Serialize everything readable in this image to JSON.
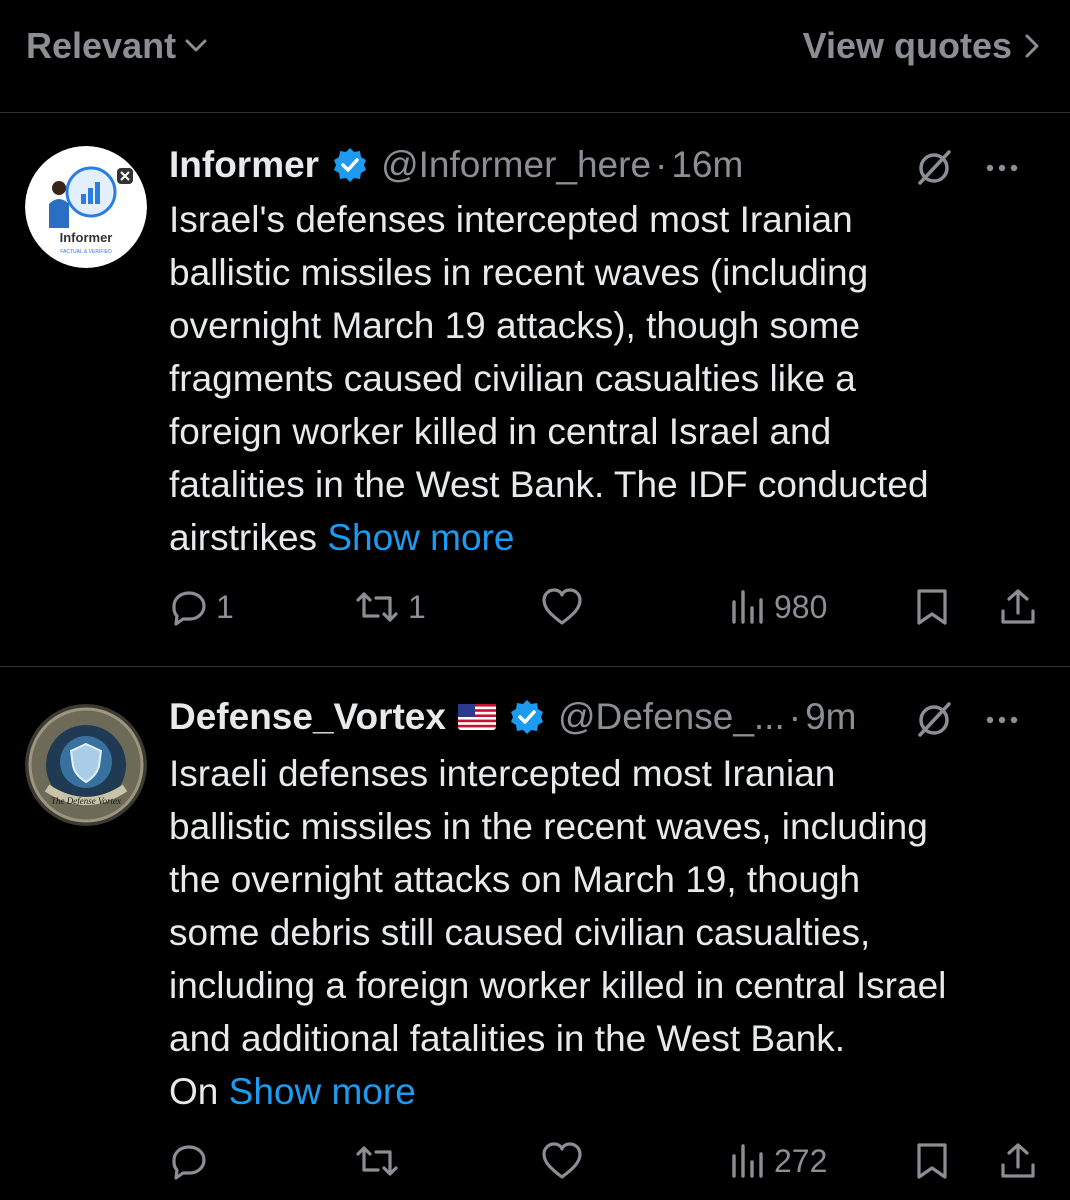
{
  "topbar": {
    "sort_label": "Relevant",
    "view_quotes_label": "View quotes"
  },
  "tweets": [
    {
      "name": "Informer",
      "handle": "@Informer_here",
      "separator": "·",
      "time": "16m",
      "avatar_text": "Informer",
      "avatar_subtext": "FACTUAL & VERIFIED",
      "lines": [
        "Israel's defenses intercepted most Iranian",
        "ballistic missiles in recent waves (including",
        "overnight March 19 attacks), though some",
        "fragments caused civilian casualties like a",
        "foreign worker killed in central Israel and",
        "fatalities in the West Bank.  The IDF conducted",
        "airstrikes "
      ],
      "show_more": "Show more",
      "replies": "1",
      "reposts": "1",
      "likes": "",
      "views": "980"
    },
    {
      "name": "Defense_Vortex",
      "flag": "us-flag-icon",
      "handle": "@Defense_...",
      "separator": "·",
      "time": "9m",
      "avatar_text": "The Defense Vortex",
      "lines": [
        "Israeli defenses intercepted most Iranian",
        "ballistic missiles in the recent waves, including",
        "the overnight attacks on March 19, though",
        "some debris still caused civilian casualties,",
        "including a foreign worker killed in central Israel",
        "and additional fatalities in the West Bank.",
        "On "
      ],
      "show_more": "Show more",
      "replies": "",
      "reposts": "",
      "likes": "",
      "views": "272"
    }
  ],
  "colors": {
    "background": "#000000",
    "text": "#e7e9ea",
    "secondary": "#8b8f94",
    "accent": "#1d9bf0",
    "divider": "#2f3336"
  }
}
